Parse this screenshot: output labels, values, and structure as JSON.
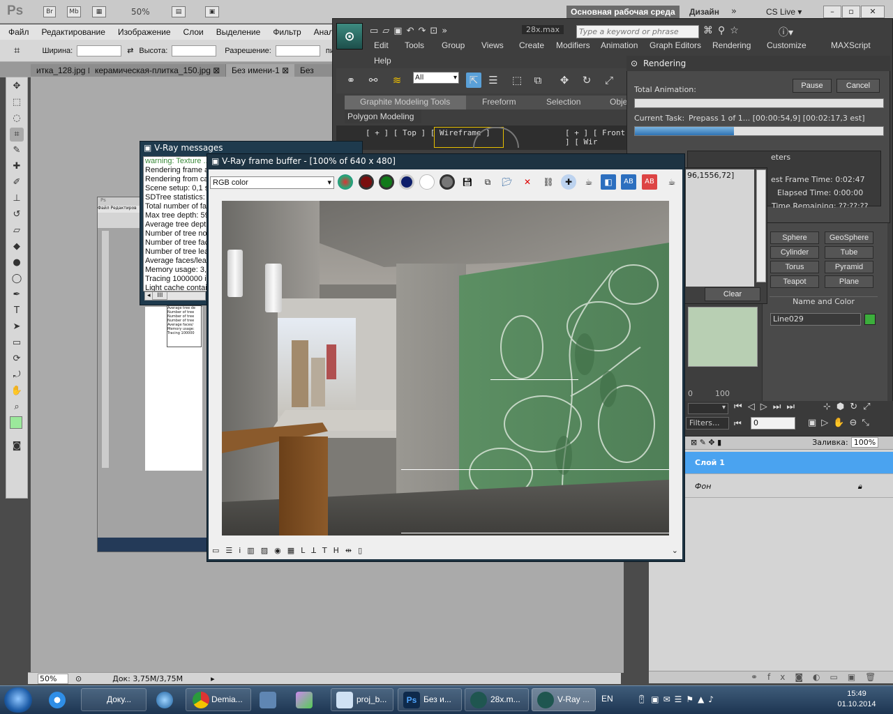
{
  "photoshop": {
    "logo": "Ps",
    "bridge": "Br",
    "mini_bridge": "Mb",
    "zoom": "50%",
    "workspace": "Основная рабочая среда",
    "design": "Дизайн",
    "cs_live": "CS Live",
    "menu": [
      "Файл",
      "Редактирование",
      "Изображение",
      "Слои",
      "Выделение",
      "Фильтр",
      "Анали"
    ],
    "options": {
      "width_label": "Ширина:",
      "height_label": "Высота:",
      "resolution_label": "Разрешение:",
      "unit": "пи"
    },
    "tabs": [
      "итка_128.jpg",
      "керамическая-плитка_150.jpg",
      "Без имени-1",
      "Без имен"
    ],
    "status": {
      "zoom": "50%",
      "doc": "Док: 3,75M/3,75M"
    },
    "layers": {
      "fill_label": "Заливка:",
      "fill_value": "100%",
      "items": [
        "Слой 1",
        "Фон"
      ]
    }
  },
  "max": {
    "filename": "28x.max",
    "search_placeholder": "Type a keyword or phrase",
    "menu": [
      "Edit",
      "Tools",
      "Group",
      "Views",
      "Create",
      "Modifiers",
      "Animation",
      "Graph Editors",
      "Rendering",
      "Customize",
      "MAXScript",
      "Help"
    ],
    "selection_filter": "All",
    "ribbon": [
      "Graphite Modeling Tools",
      "Freeform",
      "Selection",
      "Obje"
    ],
    "ribbon_sub": "Polygon Modeling",
    "viewports": [
      "[ + ] [ Top ] [ Wireframe ]",
      "[ + ] [ Front ] [ Wir"
    ],
    "primitives": [
      "Sphere",
      "GeoSphere",
      "Cylinder",
      "Tube",
      "Torus",
      "Pyramid",
      "Teapot",
      "Plane"
    ],
    "name_color_title": "Name and Color",
    "object_name": "Line029",
    "filters": "Filters...",
    "frame": "0",
    "timeline_max": "100",
    "accent": "#3cae3c"
  },
  "rendering": {
    "title": "Rendering",
    "pause": "Pause",
    "cancel": "Cancel",
    "total_label": "Total Animation:",
    "total_progress": 0,
    "task_label": "Current Task:",
    "task_value": "Prepass 1 of 1... [00:00:54,9] [00:02:17,3 est]",
    "task_progress": 0.4,
    "params_title": "eters",
    "last_frame": "est Frame Time:  0:02:47",
    "elapsed": "Elapsed Time:  0:00:00",
    "remaining": "Time Remaining:  ??:??:??",
    "coords": "96,1556,72]",
    "clear": "Clear"
  },
  "vray_messages": {
    "title": "V-Ray messages",
    "lines": [
      "warning: Texture ...",
      "Rendering frame a",
      "Rendering from ca",
      "Scene setup: 0,1 s",
      "SDTree statistics:",
      "Total number of fa",
      "Max tree depth: 59",
      "Average tree depth",
      "Number of tree no",
      "Number of tree fac",
      "Number of tree lea",
      "Average faces/lea",
      "Memory usage: 3,9",
      "Tracing 1000000 i",
      "Light cache contai"
    ]
  },
  "vfb": {
    "title": "V-Ray frame buffer - [100% of 640 x 480]",
    "channel": "RGB color",
    "colors": {
      "wall_green": "#5c8f63",
      "wall_grey": "#8a8884",
      "ceiling": "#9a968f",
      "wood": "#7a4a22"
    }
  },
  "taskbar": {
    "items": [
      "Доку...",
      "",
      "Demia...",
      "",
      "",
      "proj_b...",
      "Без и...",
      "28x.m...",
      "V-Ray ..."
    ],
    "lang": "EN",
    "time": "15:49",
    "date": "01.10.2014"
  }
}
